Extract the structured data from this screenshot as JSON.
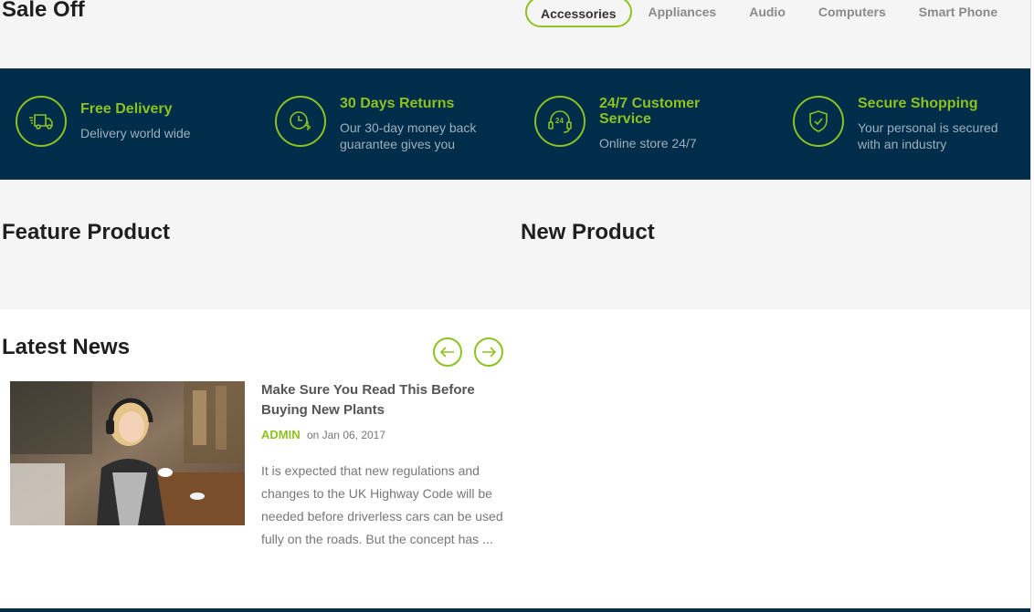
{
  "sale": {
    "title": "Sale Off",
    "tabs": [
      "Accessories",
      "Appliances",
      "Audio",
      "Computers",
      "Smart Phone"
    ]
  },
  "features": [
    {
      "title": "Free Delivery",
      "desc": [
        "Delivery world wide"
      ],
      "icon": "truck-icon"
    },
    {
      "title": "30 Days Returns",
      "desc": [
        "Our 30-day money back",
        "guarantee gives you"
      ],
      "icon": "clock-dollar-icon"
    },
    {
      "title": "24/7 Customer",
      "title2": "Service",
      "desc": [
        "Online store 24/7"
      ],
      "icon": "support-24-icon"
    },
    {
      "title": "Secure Shopping",
      "desc": [
        "Your personal is secured",
        "with an industry"
      ],
      "icon": "shield-icon"
    }
  ],
  "products": {
    "feature_title": "Feature Product",
    "new_title": "New Product"
  },
  "news": {
    "title": "Latest News",
    "headline": "Make Sure You Read This Before Buying New Plants",
    "author": "ADMIN",
    "date": "on Jan 06, 2017",
    "excerpt": "It is expected that new regulations and changes to the UK Highway Code will be needed before driverless cars can be used fully on the roads. But the concept has ..."
  },
  "colors": {
    "accent": "#8dc21f",
    "navy": "#002d4a",
    "light_bg": "#f5f5f5"
  }
}
